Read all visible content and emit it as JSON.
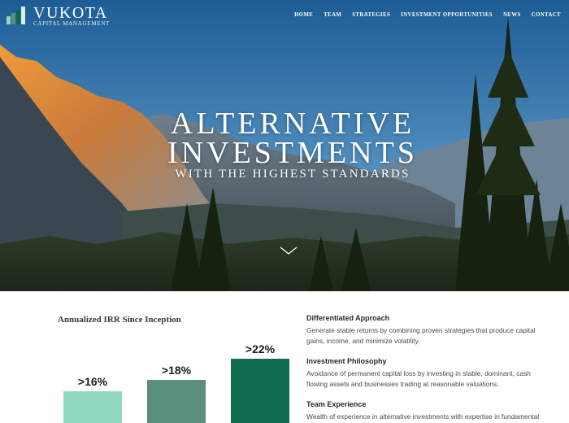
{
  "brand": {
    "name": "VUKOTA",
    "subtitle": "CAPITAL MANAGEMENT",
    "logo_colors": [
      "#8fd8bf",
      "#5a8f7b",
      "#0f6a4e"
    ]
  },
  "nav": {
    "items": [
      "HOME",
      "TEAM",
      "STRATEGIES",
      "INVESTMENT OPPORTUNITIES",
      "NEWS",
      "CONTACT"
    ]
  },
  "hero": {
    "line1": "ALTERNATIVE",
    "line2": "INVESTMENTS",
    "line3": "WITH THE HIGHEST STANDARDS",
    "scroll_icon": "chevron-down-icon"
  },
  "chart_data": {
    "type": "bar",
    "title": "Annualized IRR Since Inception",
    "categories": [
      "",
      "",
      ""
    ],
    "values": [
      16,
      18,
      22
    ],
    "labels": [
      ">16%",
      ">18%",
      ">22%"
    ],
    "colors": [
      "#8fd8bf",
      "#5a8f7b",
      "#0f6a4e"
    ],
    "ylim": [
      10,
      24
    ],
    "grid": false
  },
  "features": [
    {
      "title": "Differentiated Approach",
      "text": "Generate stable returns by combining proven strategies that produce capital gains, income, and minimize volatility."
    },
    {
      "title": "Investment Philosophy",
      "text": "Avoidance of permanent capital loss by investing in stable, dominant, cash flowing assets and businesses trading at reasonable valuations."
    },
    {
      "title": "Team Experience",
      "text": "Wealth of experience in alternative investments with expertise in fundamental"
    }
  ]
}
